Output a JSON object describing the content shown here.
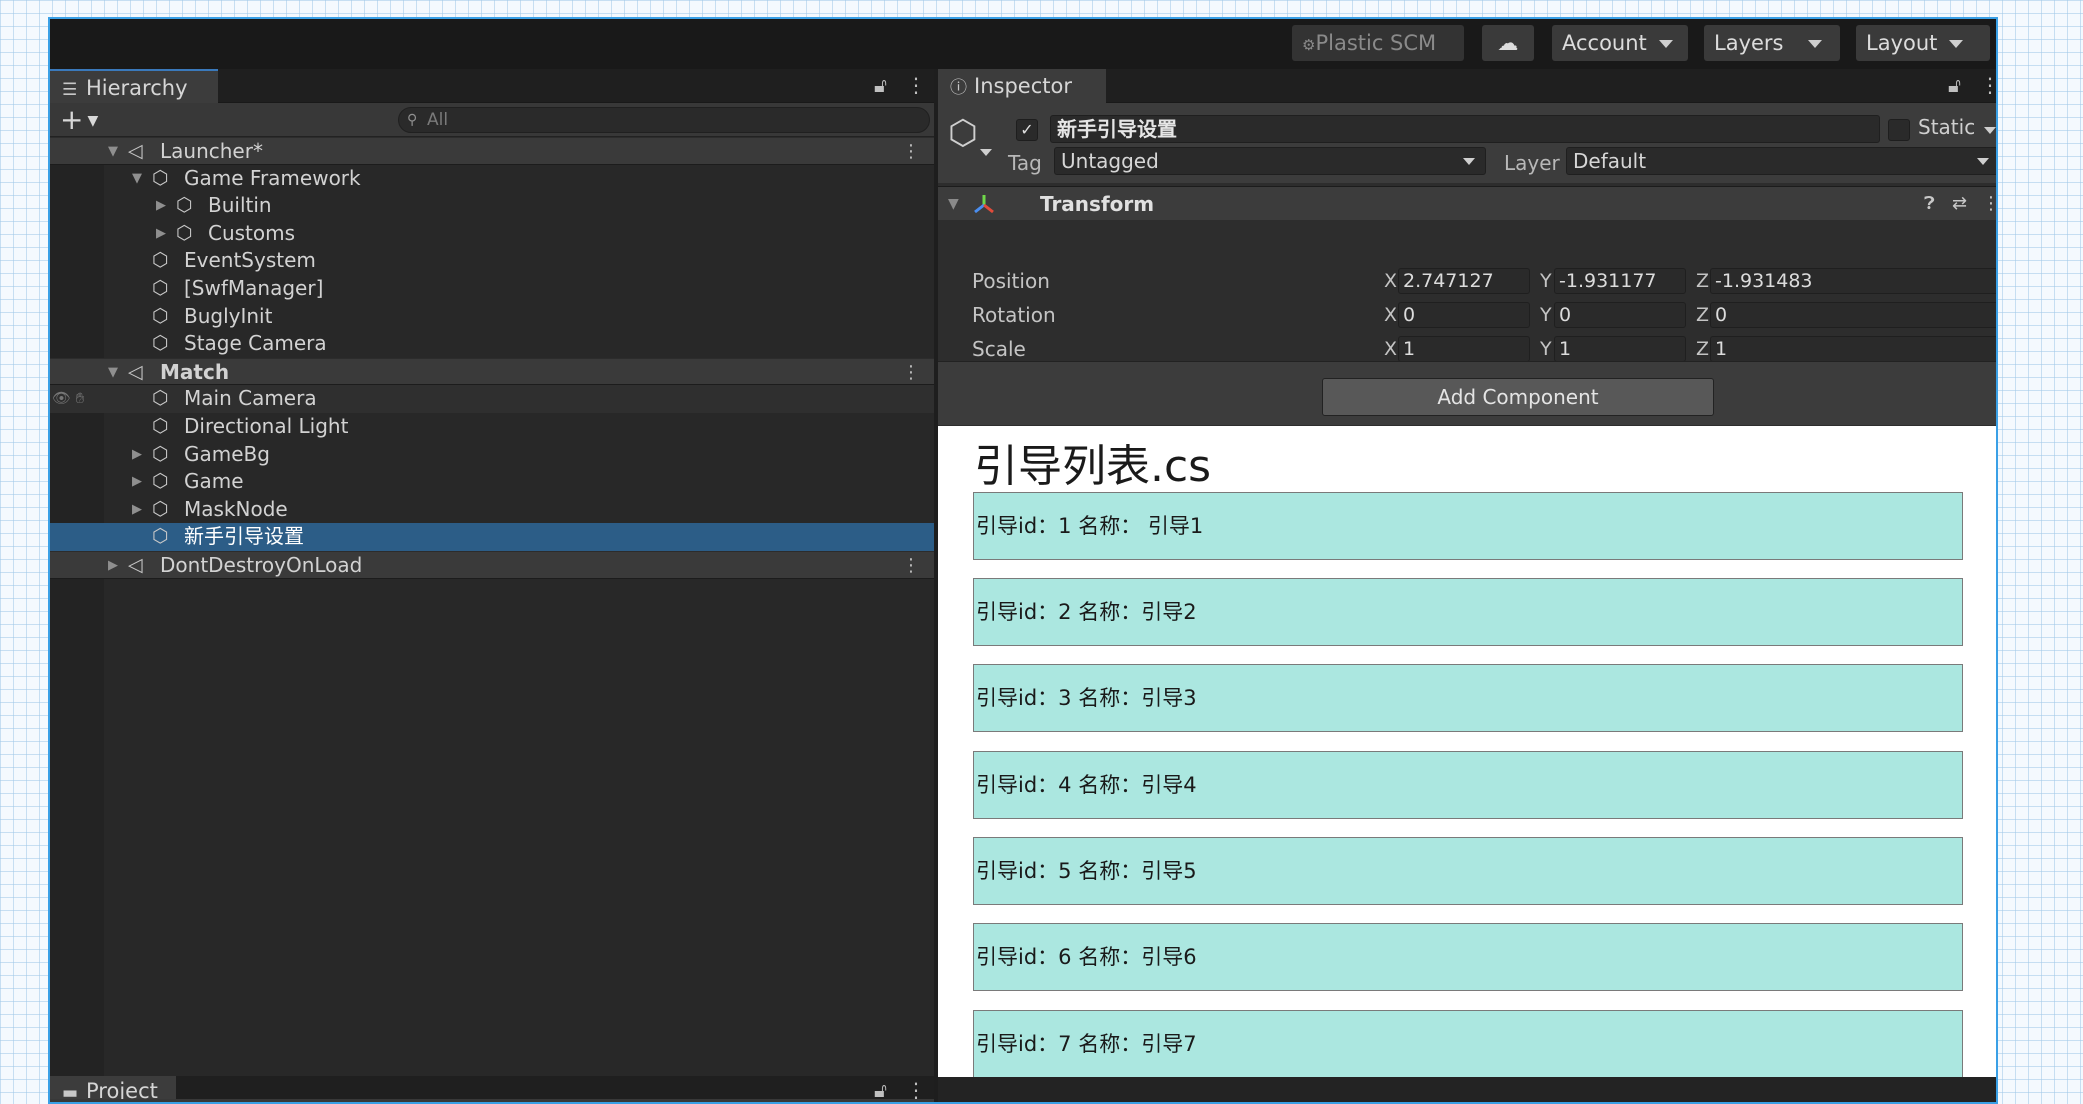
{
  "toolbar": {
    "plastic_scm": "Plastic SCM",
    "account": "Account",
    "layers": "Layers",
    "layout": "Layout"
  },
  "hierarchy": {
    "tab_label": "Hierarchy",
    "search_placeholder": "All",
    "rows": [
      {
        "label": "Launcher*"
      },
      {
        "label": "Game Framework"
      },
      {
        "label": "Builtin"
      },
      {
        "label": "Customs"
      },
      {
        "label": "EventSystem"
      },
      {
        "label": "[SwfManager]"
      },
      {
        "label": "BuglyInit"
      },
      {
        "label": "Stage Camera"
      },
      {
        "label": "Match"
      },
      {
        "label": "Main Camera"
      },
      {
        "label": "Directional Light"
      },
      {
        "label": "GameBg"
      },
      {
        "label": "Game"
      },
      {
        "label": "MaskNode"
      },
      {
        "label": "新手引导设置"
      },
      {
        "label": "DontDestroyOnLoad"
      }
    ]
  },
  "project": {
    "tab_label": "Project"
  },
  "inspector": {
    "tab_label": "Inspector",
    "object_name": "新手引导设置",
    "static_label": "Static",
    "tag_label": "Tag",
    "tag_value": "Untagged",
    "layer_label": "Layer",
    "layer_value": "Default",
    "transform_title": "Transform",
    "position_label": "Position",
    "rotation_label": "Rotation",
    "scale_label": "Scale",
    "axis_x": "X",
    "axis_y": "Y",
    "axis_z": "Z",
    "position": {
      "x": "2.747127",
      "y": "-1.931177",
      "z": "-1.931483"
    },
    "rotation": {
      "x": "0",
      "y": "0",
      "z": "0"
    },
    "scale": {
      "x": "1",
      "y": "1",
      "z": "1"
    },
    "add_component": "Add Component"
  },
  "guide_list": {
    "title": "引导列表.cs",
    "items": [
      {
        "text": "引导id：1  名称：  引导1"
      },
      {
        "text": "引导id：2   名称：引导2"
      },
      {
        "text": "引导id：3   名称：引导3"
      },
      {
        "text": "引导id：4   名称：引导4"
      },
      {
        "text": "引导id：5   名称：引导5"
      },
      {
        "text": "引导id：6   名称：引导6"
      },
      {
        "text": "引导id：7   名称：引导7"
      }
    ]
  },
  "colors": {
    "selection": "#2c5d87",
    "guide_item_bg": "#abe7e0",
    "window_border": "#3aa0e6"
  }
}
